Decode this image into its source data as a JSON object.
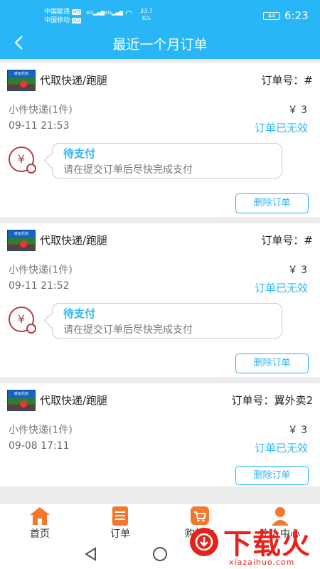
{
  "status_bar": {
    "carrier1": "中国联通",
    "carrier2": "中国移动",
    "hd": "HD",
    "net": "4G",
    "speed_value": "33.7",
    "speed_unit": "K/s",
    "battery": "44",
    "time": "6:23"
  },
  "header": {
    "title": "最近一个月订单"
  },
  "orders": [
    {
      "logo_text": "转运代收",
      "service": "代取快递/跑腿",
      "order_no": "订单号：#",
      "item": "小件快递(1件)",
      "price": "￥ 3",
      "date": "09-11 21:53",
      "status": "订单已无效",
      "pay_title": "待支付",
      "pay_text": "请在提交订单后尽快完成支付",
      "delete": "删除订单"
    },
    {
      "logo_text": "转运代收",
      "service": "代取快递/跑腿",
      "order_no": "订单号：#",
      "item": "小件快递(1件)",
      "price": "￥ 3",
      "date": "09-11 21:52",
      "status": "订单已无效",
      "pay_title": "待支付",
      "pay_text": "请在提交订单后尽快完成支付",
      "delete": "删除订单"
    },
    {
      "logo_text": "转运代收",
      "service": "代取快递/跑腿",
      "order_no": "订单号：翼外卖2",
      "item": "小件快递(1件)",
      "price": "￥ 3",
      "date": "09-08 17:11",
      "status": "订单已无效",
      "delete": "删除订单"
    }
  ],
  "tabs": [
    {
      "label": "首页",
      "icon": "home-icon"
    },
    {
      "label": "订单",
      "icon": "order-list-icon"
    },
    {
      "label": "购物车",
      "icon": "cart-icon"
    },
    {
      "label": "个人中心",
      "icon": "user-icon"
    }
  ],
  "watermark": {
    "text": "下载火",
    "sub": "xiazaihuo.com"
  },
  "colors": {
    "accent": "#29b6f6",
    "tab_active": "#f5772b",
    "danger": "#b04040",
    "watermark": "#e8221b"
  }
}
